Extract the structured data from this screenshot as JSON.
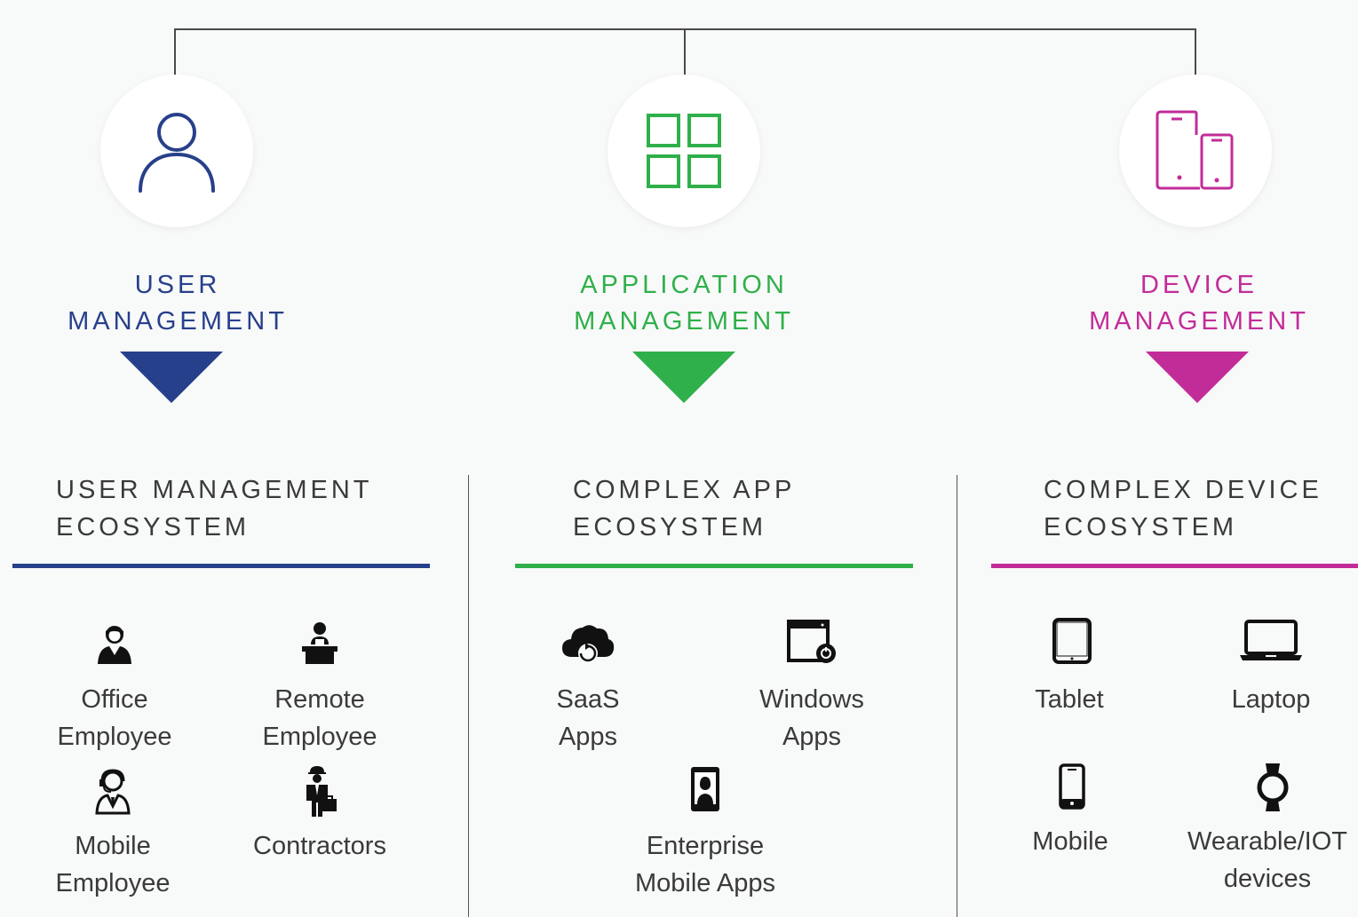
{
  "colors": {
    "user": "#27408b",
    "application": "#2fb04a",
    "device": "#c22c98",
    "text": "#3a3a3a"
  },
  "categories": {
    "user": {
      "icon": "user-icon",
      "title_line1": "USER",
      "title_line2": "MANAGEMENT"
    },
    "application": {
      "icon": "app-grid-icon",
      "title_line1": "APPLICATION",
      "title_line2": "MANAGEMENT"
    },
    "device": {
      "icon": "devices-icon",
      "title_line1": "DEVICE",
      "title_line2": "MANAGEMENT"
    }
  },
  "ecosystems": {
    "user": {
      "title_line1": "USER MANAGEMENT",
      "title_line2": "ECOSYSTEM",
      "items": [
        {
          "icon": "office-employee-icon",
          "line1": "Office",
          "line2": "Employee"
        },
        {
          "icon": "remote-employee-icon",
          "line1": "Remote",
          "line2": "Employee"
        },
        {
          "icon": "mobile-employee-icon",
          "line1": "Mobile",
          "line2": "Employee"
        },
        {
          "icon": "contractor-icon",
          "line1": "Contractors",
          "line2": ""
        }
      ]
    },
    "application": {
      "title_line1": "COMPLEX APP",
      "title_line2": "ECOSYSTEM",
      "items": [
        {
          "icon": "cloud-icon",
          "line1": "SaaS",
          "line2": "Apps"
        },
        {
          "icon": "window-icon",
          "line1": "Windows",
          "line2": "Apps"
        },
        {
          "icon": "mobile-app-icon",
          "line1": "Enterprise",
          "line2": "Mobile Apps"
        }
      ]
    },
    "device": {
      "title_line1": "COMPLEX DEVICE",
      "title_line2": "ECOSYSTEM",
      "items": [
        {
          "icon": "tablet-icon",
          "line1": "Tablet",
          "line2": ""
        },
        {
          "icon": "laptop-icon",
          "line1": "Laptop",
          "line2": ""
        },
        {
          "icon": "mobile-phone-icon",
          "line1": "Mobile",
          "line2": ""
        },
        {
          "icon": "smartwatch-icon",
          "line1": "Wearable/IOT",
          "line2": "devices"
        }
      ]
    }
  }
}
